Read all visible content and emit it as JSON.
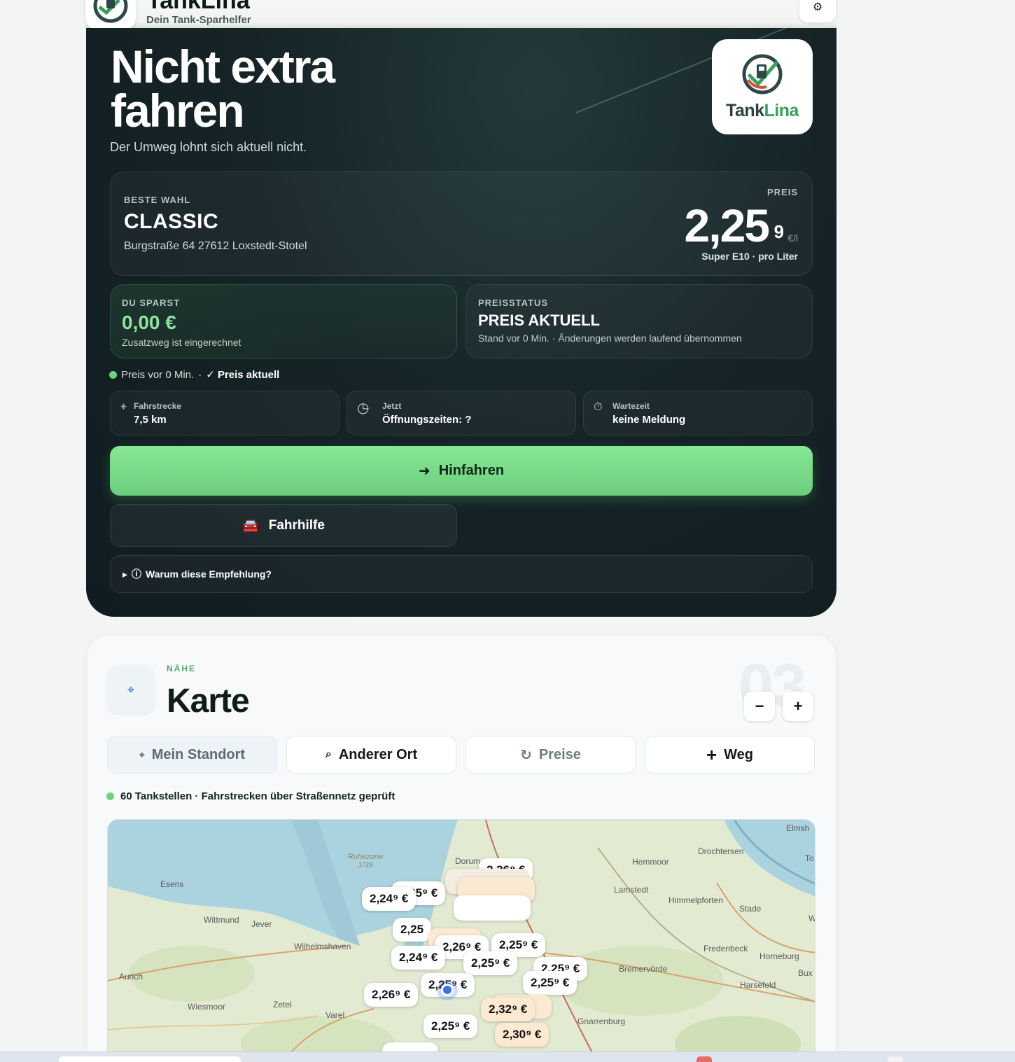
{
  "header": {
    "app_title": "TankLina",
    "app_subtitle": "Dein Tank-Sparhelfer",
    "settings_glyph": "⚙"
  },
  "hero": {
    "title": "Nicht extra fahren",
    "subtitle": "Der Umweg lohnt sich aktuell nicht.",
    "logo_word_a": "Tank",
    "logo_word_b": "Lina",
    "best": {
      "label": "BESTE WAHL",
      "brand": "CLASSIC",
      "address": "Burgstraße 64 27612 Loxstedt-Stotel",
      "price_label": "PREIS",
      "price_main": "2,25",
      "price_sup": "9",
      "price_unit": "€/l",
      "fuel": "Super E10 · pro Liter"
    },
    "savings": {
      "label": "DU SPARST",
      "amount": "0,00 €",
      "note": "Zusatzweg ist eingerechnet"
    },
    "status": {
      "label": "PREISSTATUS",
      "value": "PREIS AKTUELL",
      "note": "Stand vor 0 Min. · Änderungen werden laufend übernommen"
    },
    "live": {
      "text": "Preis vor 0 Min.",
      "sep": "·",
      "badge": "✓ Preis aktuell"
    },
    "chips": [
      {
        "icon": "⌖",
        "key": "Fahrstrecke",
        "value": "7,5 km"
      },
      {
        "icon": "◷",
        "key": "Jetzt",
        "value": "Öffnungszeiten: ?"
      },
      {
        "icon": "⏱",
        "key": "Wartezeit",
        "value": "keine Meldung"
      }
    ],
    "go_button": {
      "arrow": "➜",
      "label": "Hinfahren"
    },
    "help_button": {
      "icon": "🚘",
      "label": "Fahrhilfe"
    },
    "why": {
      "caret": "▸",
      "info": "ⓘ",
      "label": "Warum diese Empfehlung?"
    }
  },
  "map_section": {
    "eyebrow": "NÄHE",
    "title": "Karte",
    "number": "03",
    "zoom_out": "−",
    "zoom_in": "+",
    "buttons": [
      {
        "icon": "⌖",
        "label": "Mein Standort"
      },
      {
        "icon": "⌕",
        "label": "Anderer Ort"
      },
      {
        "icon": "↻",
        "label": "Preise"
      },
      {
        "icon": "+",
        "label": "Weg"
      }
    ],
    "stations_text": "60 Tankstellen · Fahrstrecken über Straßennetz geprüft",
    "places": [
      "Esens",
      "Wittmund",
      "Jever",
      "Wilhelmshaven",
      "Aurich",
      "Wiesmoor",
      "Zetel",
      "Varel",
      "Ruhezone 1/39",
      "Dorum",
      "Hemmoor",
      "Lamstedt",
      "Himmelpforten",
      "Stade",
      "Drochtersen",
      "Fredenbeck",
      "Horneburg",
      "Bremervörde",
      "Harsefeld",
      "Gnarrenburg",
      "Elmsh",
      "To",
      "W",
      "Bux"
    ],
    "price_pins": [
      {
        "label": "2,26⁹ €"
      },
      {
        "label": "2,24⁹ €"
      },
      {
        "label": "2,25⁹ €"
      },
      {
        "label": "2,25"
      },
      {
        "label": "2,26⁹ €"
      },
      {
        "label": "2,25⁹ €"
      },
      {
        "label": "2,24⁹ €"
      },
      {
        "label": "2,25⁹ €"
      },
      {
        "label": "2,25⁹ €"
      },
      {
        "label": "2,25⁹ €"
      },
      {
        "label": "2,26⁹ €"
      },
      {
        "label": "2,25⁹ €"
      },
      {
        "label": "2,32⁹ €"
      },
      {
        "label": "2,25⁹ €"
      },
      {
        "label": "2,30⁹ €"
      }
    ]
  }
}
